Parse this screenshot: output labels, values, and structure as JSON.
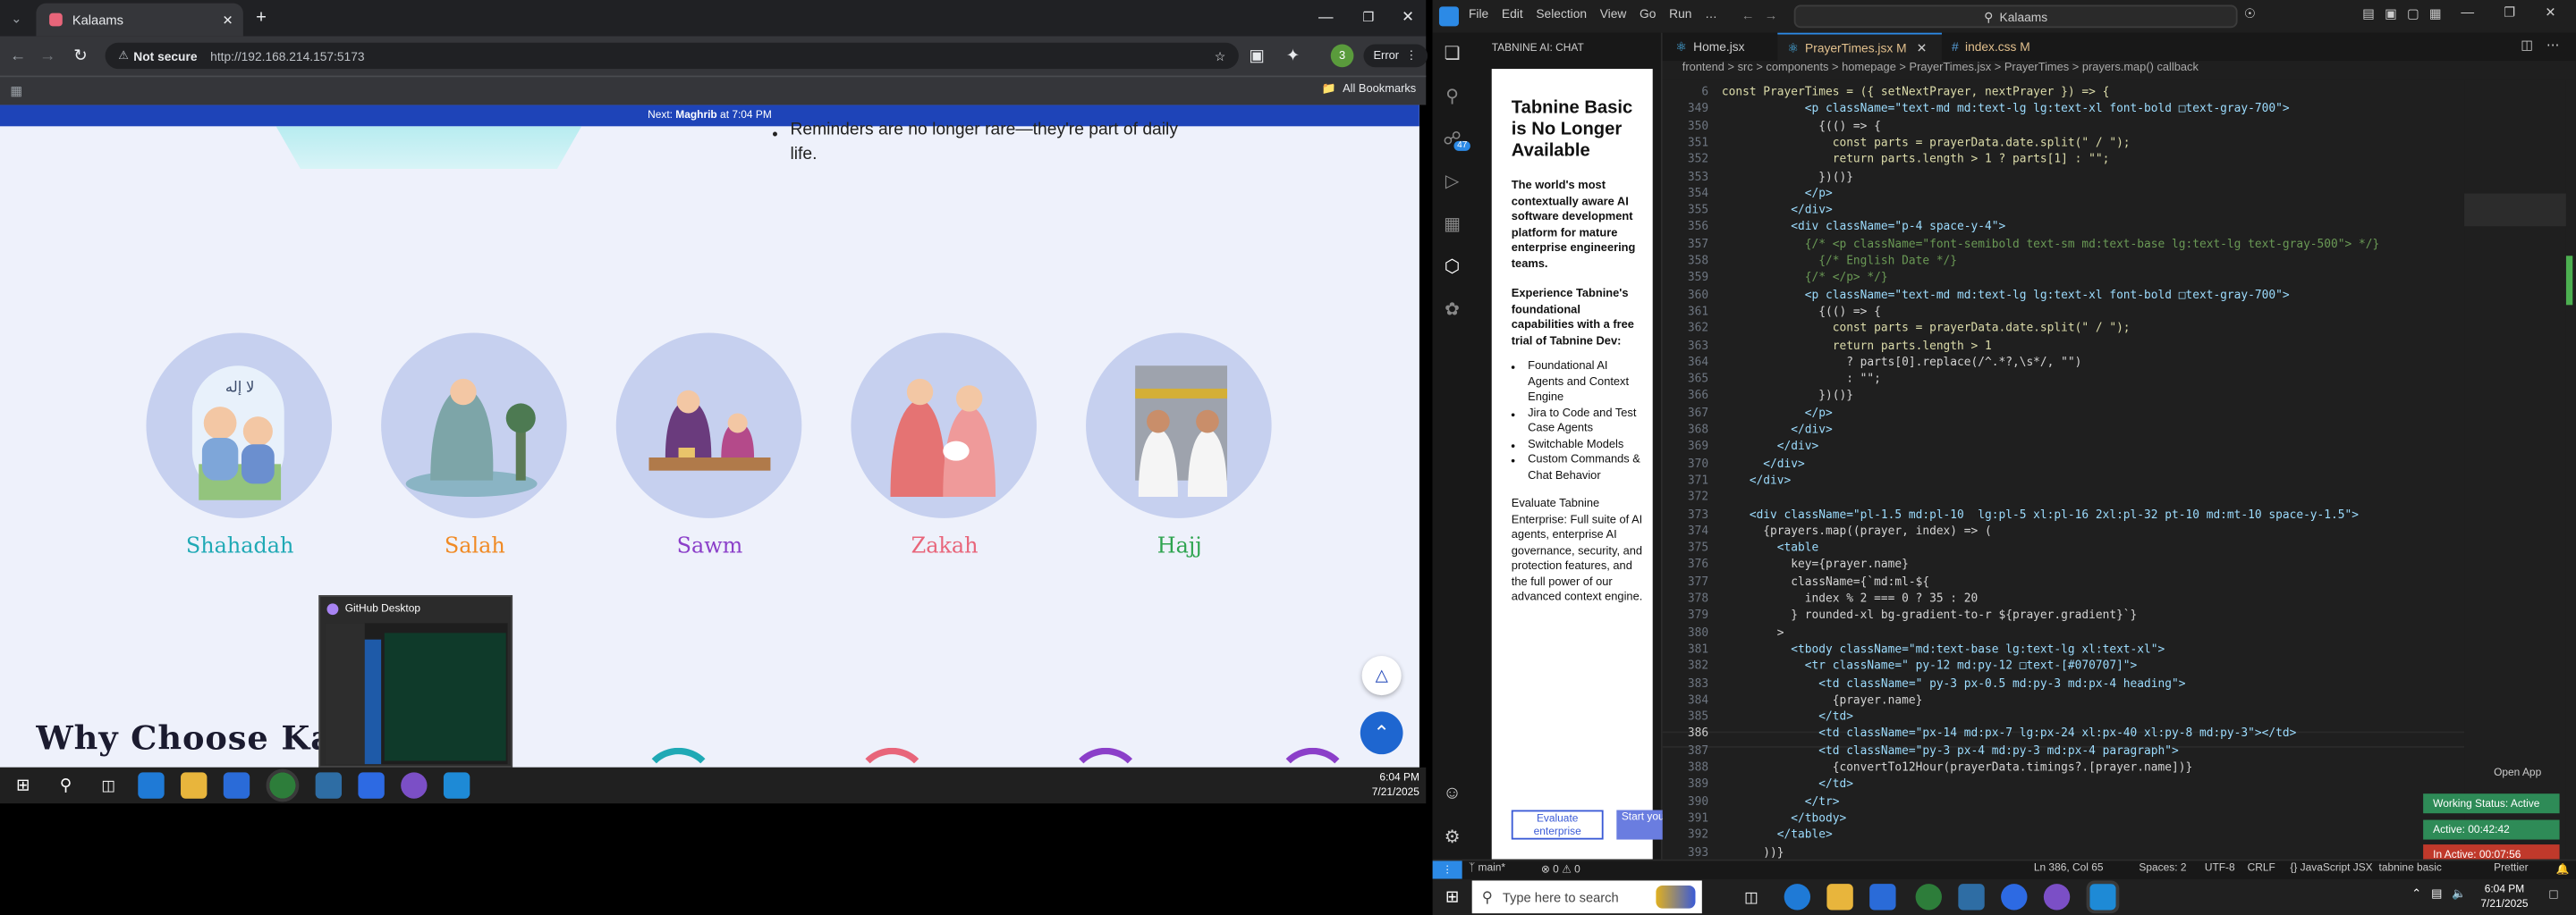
{
  "browser": {
    "tab_title": "Kalaams",
    "url_security": "Not secure",
    "url": "http://192.168.214.157:5173",
    "profile_initial": "3",
    "error_label": "Error",
    "bookmarks_label": "All Bookmarks"
  },
  "website": {
    "next_prayer_prefix": "Next:",
    "next_prayer_name": "Maghrib",
    "next_prayer_time": "at 7:04 PM",
    "bullet_text_1": "Reminders are no longer rare—they're part of daily",
    "bullet_text_2": "life.",
    "pillars": [
      {
        "name": "Shahadah",
        "color": "#1fa9b5"
      },
      {
        "name": "Salah",
        "color": "#f08a24"
      },
      {
        "name": "Sawm",
        "color": "#8b3fc9"
      },
      {
        "name": "Zakah",
        "color": "#e8657a"
      },
      {
        "name": "Hajj",
        "color": "#2ea44f"
      }
    ],
    "why_heading": "Why Choose Kala"
  },
  "github_preview": {
    "title": "GitHub Desktop"
  },
  "taskbar_left": {
    "time": "6:04 PM",
    "date": "7/21/2025"
  },
  "vscode": {
    "menu": [
      "File",
      "Edit",
      "Selection",
      "View",
      "Go",
      "Run",
      "…"
    ],
    "search": "Kalaams",
    "badge_count": "47",
    "tabnine": {
      "panel_title": "TABNINE AI: CHAT",
      "heading": "Tabnine Basic is No Longer Available",
      "p1": "The world's most contextually aware AI software development platform for mature enterprise engineering teams.",
      "p2": "Experience Tabnine's foundational capabilities with a free trial of Tabnine Dev:",
      "bullets": [
        "Foundational AI Agents and Context Engine",
        "Jira to Code and Test Case Agents",
        "Switchable Models",
        "Custom Commands & Chat Behavior"
      ],
      "p3": "Evaluate Tabnine Enterprise: Full suite of AI agents, enterprise AI governance, security, and protection features, and the full power of our advanced context engine.",
      "btn_eval": "Evaluate enterprise",
      "btn_trial": "Start your Dev trial"
    },
    "tabs": [
      {
        "label": "Home.jsx",
        "mod": ""
      },
      {
        "label": "PrayerTimes.jsx",
        "mod": "M"
      },
      {
        "label": "index.css",
        "mod": "M"
      }
    ],
    "breadcrumb": "frontend > src > components > homepage > PrayerTimes.jsx > PrayerTimes > prayers.map() callback",
    "code_lines": [
      {
        "n": "6",
        "t": "const PrayerTimes = ({ setNextPrayer, nextPrayer }) => {"
      },
      {
        "n": "349",
        "t": "            <p className=\"text-md md:text-lg lg:text-xl font-bold □text-gray-700\">"
      },
      {
        "n": "350",
        "t": "              {(() => {"
      },
      {
        "n": "351",
        "t": "                const parts = prayerData.date.split(\" / \");"
      },
      {
        "n": "352",
        "t": "                return parts.length > 1 ? parts[1] : \"\";"
      },
      {
        "n": "353",
        "t": "              })()}"
      },
      {
        "n": "354",
        "t": "            </p>"
      },
      {
        "n": "355",
        "t": "          </div>"
      },
      {
        "n": "356",
        "t": "          <div className=\"p-4 space-y-4\">"
      },
      {
        "n": "357",
        "t": "            {/* <p className=\"font-semibold text-sm md:text-base lg:text-lg text-gray-500\"> */}"
      },
      {
        "n": "358",
        "t": "              {/* English Date */}"
      },
      {
        "n": "359",
        "t": "            {/* </p> */}"
      },
      {
        "n": "360",
        "t": "            <p className=\"text-md md:text-lg lg:text-xl font-bold □text-gray-700\">"
      },
      {
        "n": "361",
        "t": "              {(() => {"
      },
      {
        "n": "362",
        "t": "                const parts = prayerData.date.split(\" / \");"
      },
      {
        "n": "363",
        "t": "                return parts.length > 1"
      },
      {
        "n": "364",
        "t": "                  ? parts[0].replace(/^.*?,\\s*/, \"\")"
      },
      {
        "n": "365",
        "t": "                  : \"\";"
      },
      {
        "n": "366",
        "t": "              })()}"
      },
      {
        "n": "367",
        "t": "            </p>"
      },
      {
        "n": "368",
        "t": "          </div>"
      },
      {
        "n": "369",
        "t": "        </div>"
      },
      {
        "n": "370",
        "t": "      </div>"
      },
      {
        "n": "371",
        "t": "    </div>"
      },
      {
        "n": "372",
        "t": ""
      },
      {
        "n": "373",
        "t": "    <div className=\"pl-1.5 md:pl-10  lg:pl-5 xl:pl-16 2xl:pl-32 pt-10 md:mt-10 space-y-1.5\">"
      },
      {
        "n": "374",
        "t": "      {prayers.map((prayer, index) => ("
      },
      {
        "n": "375",
        "t": "        <table"
      },
      {
        "n": "376",
        "t": "          key={prayer.name}"
      },
      {
        "n": "377",
        "t": "          className={`md:ml-${"
      },
      {
        "n": "378",
        "t": "            index % 2 === 0 ? 35 : 20"
      },
      {
        "n": "379",
        "t": "          } rounded-xl bg-gradient-to-r ${prayer.gradient}`}"
      },
      {
        "n": "380",
        "t": "        >"
      },
      {
        "n": "381",
        "t": "          <tbody className=\"md:text-base lg:text-lg xl:text-xl\">"
      },
      {
        "n": "382",
        "t": "            <tr className=\" py-12 md:py-12 □text-[#070707]\">"
      },
      {
        "n": "383",
        "t": "              <td className=\" py-3 px-0.5 md:py-3 md:px-4 heading\">"
      },
      {
        "n": "384",
        "t": "                {prayer.name}"
      },
      {
        "n": "385",
        "t": "              </td>"
      },
      {
        "n": "386",
        "t": "              <td className=\"px-14 md:px-7 lg:px-24 xl:px-40 xl:py-8 md:py-3\"></td>"
      },
      {
        "n": "387",
        "t": "              <td className=\"py-3 px-4 md:py-3 md:px-4 paragraph\">"
      },
      {
        "n": "388",
        "t": "                {convertTo12Hour(prayerData.timings?.[prayer.name])}"
      },
      {
        "n": "389",
        "t": "              </td>"
      },
      {
        "n": "390",
        "t": "            </tr>"
      },
      {
        "n": "391",
        "t": "          </tbody>"
      },
      {
        "n": "392",
        "t": "        </table>"
      },
      {
        "n": "393",
        "t": "      ))}"
      }
    ],
    "statusbar": {
      "branch": "main*",
      "problems": "⊗ 0 ⚠ 0",
      "cursor": "Ln 386, Col 65",
      "spaces": "Spaces: 2",
      "encoding": "UTF-8",
      "eol": "CRLF",
      "language": "JavaScript JSX",
      "tabnine": "tabnine basic",
      "prettier": "Prettier"
    },
    "open_app": "Open App",
    "working_status": "Working Status: Active",
    "active_time": "Active: 00:42:42",
    "inactive_time": "In Active: 00:07:56"
  },
  "taskbar_right": {
    "search_placeholder": "Type here to search",
    "time": "6:04 PM",
    "date": "7/21/2025"
  }
}
